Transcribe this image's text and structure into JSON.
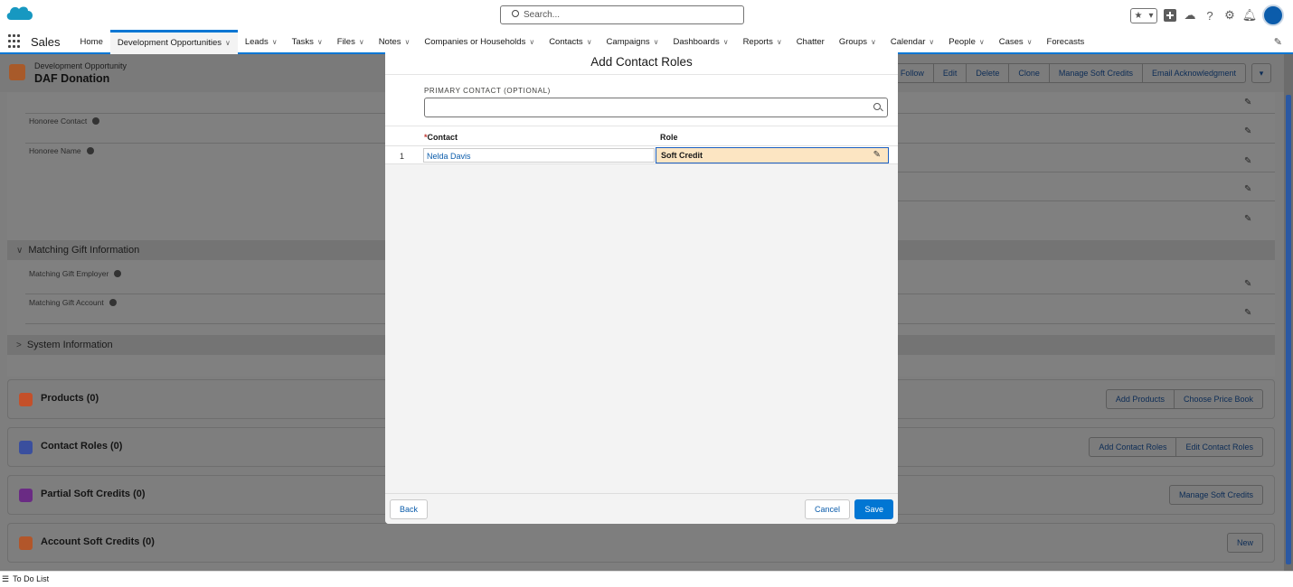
{
  "header": {
    "search_placeholder": "Search...",
    "icons": [
      "favorites-star-icon",
      "favorites-dropdown-icon",
      "add-icon",
      "trailhead-icon",
      "help-icon",
      "gear-icon",
      "bell-icon",
      "avatar"
    ]
  },
  "nav": {
    "app_name": "Sales",
    "items": [
      {
        "label": "Home",
        "dropdown": false
      },
      {
        "label": "Development Opportunities",
        "dropdown": true,
        "active": true
      },
      {
        "label": "Leads",
        "dropdown": true
      },
      {
        "label": "Tasks",
        "dropdown": true
      },
      {
        "label": "Files",
        "dropdown": true
      },
      {
        "label": "Notes",
        "dropdown": true
      },
      {
        "label": "Companies or Households",
        "dropdown": true
      },
      {
        "label": "Contacts",
        "dropdown": true
      },
      {
        "label": "Campaigns",
        "dropdown": true
      },
      {
        "label": "Dashboards",
        "dropdown": true
      },
      {
        "label": "Reports",
        "dropdown": true
      },
      {
        "label": "Chatter",
        "dropdown": false
      },
      {
        "label": "Groups",
        "dropdown": true
      },
      {
        "label": "Calendar",
        "dropdown": true
      },
      {
        "label": "People",
        "dropdown": true
      },
      {
        "label": "Cases",
        "dropdown": true
      },
      {
        "label": "Forecasts",
        "dropdown": false
      }
    ]
  },
  "record": {
    "type": "Development Opportunity",
    "name": "DAF Donation",
    "actions": [
      "Follow",
      "Edit",
      "Delete",
      "Clone",
      "Manage Soft Credits",
      "Email Acknowledgment"
    ]
  },
  "details": {
    "fields": [
      "Honoree Contact",
      "Honoree Name"
    ],
    "matching_section": "Matching Gift Information",
    "matching_fields": [
      "Matching Gift Employer",
      "Matching Gift Account"
    ],
    "system_section": "System Information"
  },
  "related": {
    "products": {
      "title": "Products (0)",
      "buttons": [
        "Add Products",
        "Choose Price Book"
      ]
    },
    "contact_roles": {
      "title": "Contact Roles (0)",
      "buttons": [
        "Add Contact Roles",
        "Edit Contact Roles"
      ]
    },
    "partial_soft_credits": {
      "title": "Partial Soft Credits (0)",
      "buttons": [
        "Manage Soft Credits"
      ]
    },
    "account_soft_credits": {
      "title": "Account Soft Credits (0)",
      "buttons": [
        "New"
      ]
    }
  },
  "footer": {
    "todo_label": "To Do List"
  },
  "modal": {
    "title": "Add Contact Roles",
    "primary_contact_label": "PRIMARY CONTACT (OPTIONAL)",
    "primary_contact_value": "",
    "columns": {
      "contact": "Contact",
      "required_marker": "*",
      "role": "Role"
    },
    "rows": [
      {
        "num": "1",
        "contact": "Nelda Davis",
        "role": "Soft Credit"
      }
    ],
    "buttons": {
      "back": "Back",
      "cancel": "Cancel",
      "save": "Save"
    },
    "close_icon": "close-icon"
  },
  "colors": {
    "brand": "#0176d3",
    "role_cell_bg": "#fce5c2"
  }
}
